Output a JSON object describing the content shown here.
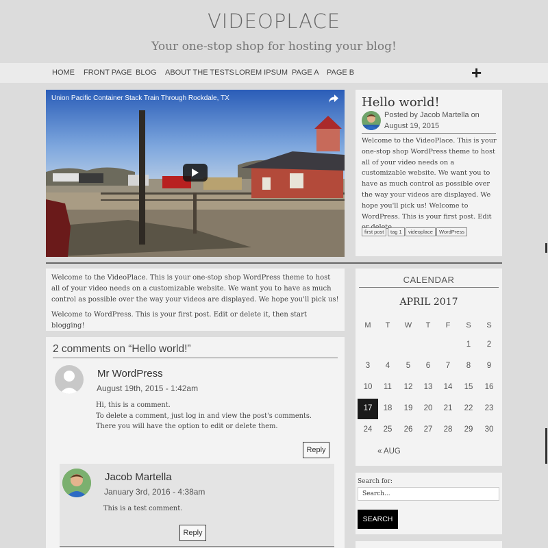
{
  "site": {
    "title": "VIDEOPLACE",
    "tagline": "Your one-stop shop for hosting your blog!"
  },
  "nav": {
    "items": [
      "HOME",
      "FRONT PAGE",
      "BLOG",
      "ABOUT THE TESTS",
      "LOREM IPSUM",
      "PAGE A",
      "PAGE B"
    ],
    "plus_icon": "plus-icon"
  },
  "video": {
    "title": "Union Pacific Container Stack Train Through Rockdale, TX",
    "share_icon": "share-icon",
    "play_icon": "play-icon"
  },
  "post": {
    "title": "Hello world!",
    "posted_by": "Posted by Jacob Martella on",
    "date": "August 19, 2015",
    "excerpt": "Welcome to the VideoPlace. This is your one-stop shop WordPress theme to host all of your video needs on a customizable website. We want you to have as much control as possible over the way your videos are displayed. We hope you'll pick us! Welcome to WordPress. This is your first post. Edit or delete",
    "tags": [
      "first post",
      "tag 1",
      "videoplace",
      "WordPress"
    ]
  },
  "content": {
    "paragraph1": "Welcome to the VideoPlace. This is your one-stop shop WordPress theme to host all of your video needs on a customizable website. We want you to have as much control as possible over the way your videos are displayed. We hope you'll pick us!",
    "paragraph2": "Welcome to WordPress. This is your first post. Edit or delete it, then start blogging!"
  },
  "comments": {
    "heading": "2 comments on “Hello world!”",
    "items": [
      {
        "author": "Mr WordPress",
        "date": "August 19th, 2015 - 1:42am",
        "text1": "Hi, this is a comment.",
        "text2": "To delete a comment, just log in and view the post's comments. There you will have the option to edit or delete them.",
        "reply": "Reply"
      },
      {
        "author": "Jacob Martella",
        "date": "January 3rd, 2016 - 4:38am",
        "text1": "This is a test comment.",
        "reply": "Reply"
      }
    ]
  },
  "calendar": {
    "title": "CALENDAR",
    "month": "APRIL 2017",
    "weekdays": [
      "M",
      "T",
      "W",
      "T",
      "F",
      "S",
      "S"
    ],
    "weeks": [
      [
        "",
        "",
        "",
        "",
        "",
        "1",
        "2"
      ],
      [
        "3",
        "4",
        "5",
        "6",
        "7",
        "8",
        "9"
      ],
      [
        "10",
        "11",
        "12",
        "13",
        "14",
        "15",
        "16"
      ],
      [
        "17",
        "18",
        "19",
        "20",
        "21",
        "22",
        "23"
      ],
      [
        "24",
        "25",
        "26",
        "27",
        "28",
        "29",
        "30"
      ]
    ],
    "today": "17",
    "prev": "« AUG"
  },
  "search": {
    "label": "Search for:",
    "placeholder": "Search...",
    "button": "SEARCH"
  },
  "colors": {
    "page_bg": "#dcdcdc",
    "panel_bg": "#f3f3f3",
    "nav_bg": "#ebebeb",
    "today_bg": "#1a1a1a",
    "button_bg": "#000000"
  }
}
